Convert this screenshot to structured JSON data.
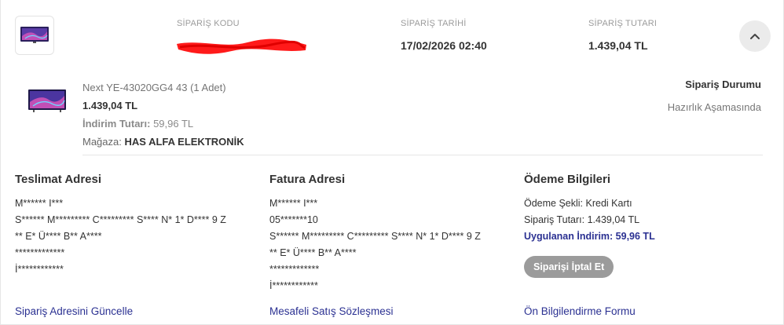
{
  "header": {
    "order_code_label": "SİPARİŞ KODU",
    "order_date_label": "SİPARİŞ TARİHİ",
    "order_date": "17/02/2026 02:40",
    "order_total_label": "SİPARİŞ TUTARI",
    "order_total": "1.439,04 TL",
    "collapse_icon": "chevron-up-icon"
  },
  "product": {
    "name": "Next YE-43020GG4 43 (1 Adet)",
    "price": "1.439,04 TL",
    "discount_label": "İndirim Tutarı:",
    "discount_value": "59,96 TL",
    "store_label": "Mağaza:",
    "store_name": "HAS ALFA ELEKTRONİK"
  },
  "status": {
    "title": "Sipariş Durumu",
    "value": "Hazırlık Aşamasında"
  },
  "delivery": {
    "title": "Teslimat Adresi",
    "lines": [
      "M****** I***",
      "S****** M********* C********* S**** N* 1* D**** 9 Z",
      "** E* Ü**** B** A****",
      "*************",
      "İ************"
    ],
    "link": "Sipariş Adresini Güncelle"
  },
  "invoice": {
    "title": "Fatura Adresi",
    "lines": [
      "M****** I***",
      "05*******10",
      "S****** M********* C********* S**** N* 1* D**** 9 Z",
      "** E* Ü**** B** A****",
      "*************",
      "İ************"
    ],
    "link": "Mesafeli Satış Sözleşmesi"
  },
  "payment": {
    "title": "Ödeme Bilgileri",
    "method": "Ödeme Şekli: Kredi Kartı",
    "total": "Sipariş Tutarı: 1.439,04 TL",
    "discount": "Uygulanan İndirim: 59,96 TL",
    "cancel_button": "Siparişi İptal Et",
    "link": "Ön Bilgilendirme Formu"
  },
  "colors": {
    "accent": "#2b3192",
    "redaction": "#ff1a1a"
  }
}
